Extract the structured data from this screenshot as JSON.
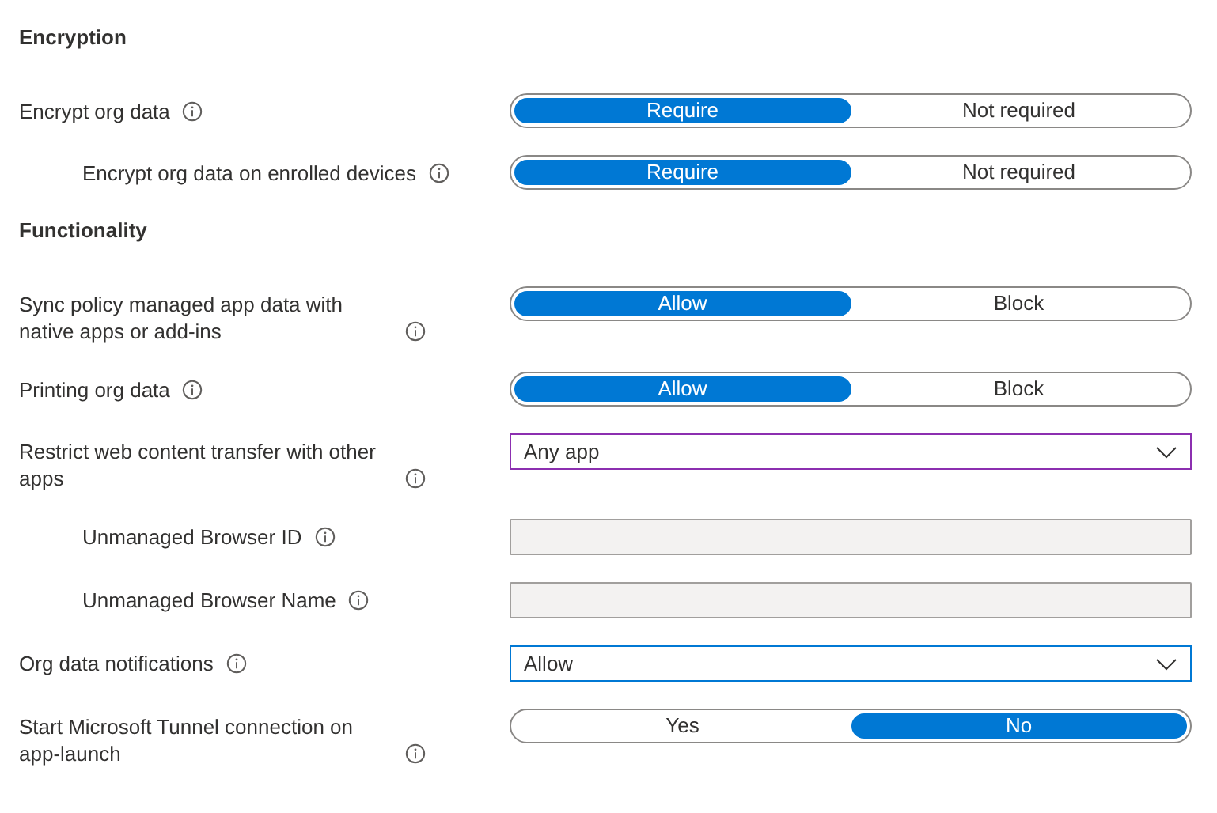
{
  "items": [
    {
      "kind": "heading",
      "text": "Encryption"
    },
    {
      "kind": "toggle",
      "label": "Encrypt org data",
      "indented": false,
      "options": [
        {
          "label": "Require",
          "selected": true
        },
        {
          "label": "Not required",
          "selected": false
        }
      ]
    },
    {
      "kind": "toggle",
      "label": "Encrypt org data on enrolled devices",
      "indented": true,
      "options": [
        {
          "label": "Require",
          "selected": true
        },
        {
          "label": "Not required",
          "selected": false
        }
      ]
    },
    {
      "kind": "heading",
      "text": "Functionality"
    },
    {
      "kind": "toggle",
      "label": "Sync policy managed app data with native apps or add-ins",
      "indented": false,
      "options": [
        {
          "label": "Allow",
          "selected": true
        },
        {
          "label": "Block",
          "selected": false
        }
      ]
    },
    {
      "kind": "toggle",
      "label": "Printing org data",
      "indented": false,
      "options": [
        {
          "label": "Allow",
          "selected": true
        },
        {
          "label": "Block",
          "selected": false
        }
      ]
    },
    {
      "kind": "dropdown",
      "label": "Restrict web content transfer with other apps",
      "indented": false,
      "value": "Any app",
      "focused": true
    },
    {
      "kind": "text-field",
      "label": "Unmanaged Browser ID",
      "indented": true,
      "disabled": true
    },
    {
      "kind": "text-field",
      "label": "Unmanaged Browser Name",
      "indented": true,
      "disabled": true
    },
    {
      "kind": "dropdown",
      "label": "Org data notifications",
      "indented": false,
      "value": "Allow",
      "focused": false
    },
    {
      "kind": "toggle",
      "label": "Start Microsoft Tunnel connection on app-launch",
      "indented": false,
      "options": [
        {
          "label": "Yes",
          "selected": false
        },
        {
          "label": "No",
          "selected": true
        }
      ]
    }
  ]
}
